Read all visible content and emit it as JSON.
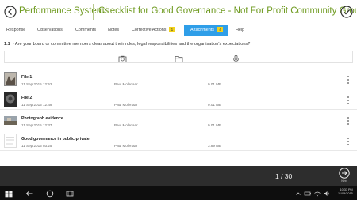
{
  "header": {
    "app_title": "Performance Systems",
    "doc_title": "Checklist for Good Governance - Not For Profit Community Groups"
  },
  "tabs": [
    {
      "label": "Response",
      "active": false
    },
    {
      "label": "Observations",
      "active": false
    },
    {
      "label": "Comments",
      "active": false
    },
    {
      "label": "Notes",
      "active": false
    },
    {
      "label": "Corrective Actions",
      "badge": "1",
      "active": false
    },
    {
      "label": "Attachments",
      "badge": "4",
      "active": true
    },
    {
      "label": "Help",
      "active": false
    }
  ],
  "question": {
    "number": "1.1",
    "text": "- Are your board or committee members clear about their roles, legal responsibilities and the organisation's expectations?"
  },
  "toolbar": {
    "icons": [
      "camera-icon",
      "folder-icon",
      "microphone-icon"
    ]
  },
  "attachments": [
    {
      "name": "File 1",
      "date": "11 Sep 2015 12:52",
      "user": "Paul Molenaar",
      "size": "0.01 MB",
      "thumb": "photo"
    },
    {
      "name": "File 2",
      "date": "11 Sep 2015 12:49",
      "user": "Paul Molenaar",
      "size": "0.01 MB",
      "thumb": "photo-dark"
    },
    {
      "name": "Photograph evidence",
      "date": "11 Sep 2015 12:37",
      "user": "Paul Molenaar",
      "size": "0.01 MB",
      "thumb": "photo-landscape"
    },
    {
      "name": "Good governance in public-private",
      "date": "11 Sep 2015 03:25",
      "user": "Paul Molenaar",
      "size": "3.89 MB",
      "thumb": "document"
    }
  ],
  "footer": {
    "pager": "1 / 30",
    "next_label": "Next"
  },
  "taskbar": {
    "time": "10:33 PM",
    "date": "11/09/2015"
  },
  "colors": {
    "title_green": "#6e9a1f",
    "tab_active": "#2f9ee8",
    "badge_yellow": "#f2d21b",
    "footer_bg": "#2d2d2d",
    "taskbar_bg": "#0e0e0e"
  }
}
